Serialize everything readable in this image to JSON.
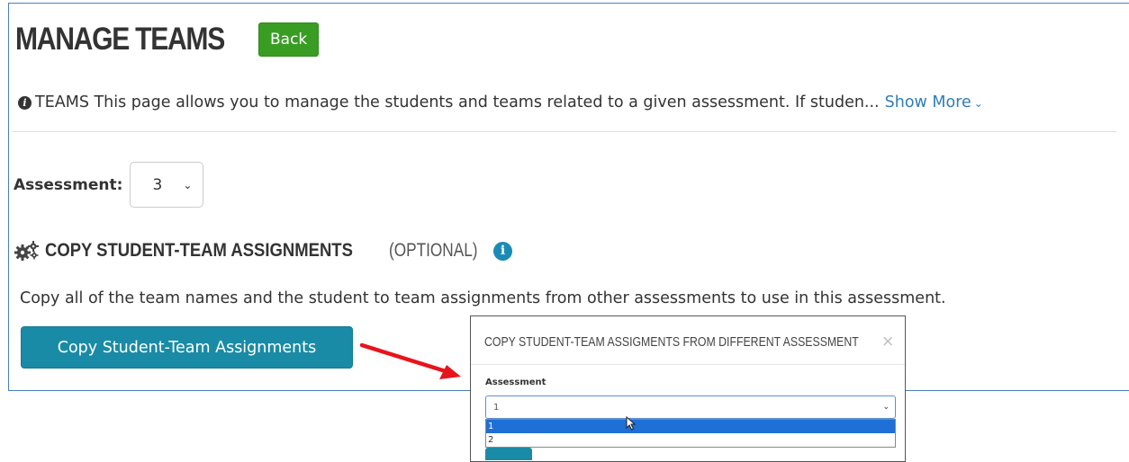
{
  "header": {
    "title": "MANAGE TEAMS",
    "back_label": "Back"
  },
  "info": {
    "text": "TEAMS This page allows you to manage the students and teams related to a given assessment. If studen...",
    "show_more": "Show More"
  },
  "assessment": {
    "label": "Assessment:",
    "selected": "3"
  },
  "copy_section": {
    "title": "COPY STUDENT-TEAM ASSIGNMENTS",
    "optional": "(OPTIONAL)",
    "description": "Copy all of the team names and the student to team assignments from other assessments to use in this assessment.",
    "button_label": "Copy Student-Team Assignments"
  },
  "modal": {
    "title": "COPY STUDENT-TEAM ASSIGMENTS FROM DIFFERENT ASSESSMENT",
    "close": "×",
    "field_label": "Assessment",
    "selected": "1",
    "options": [
      "1",
      "2"
    ]
  },
  "colors": {
    "back_button": "#3a9d23",
    "primary_button": "#1a8ba6",
    "link": "#2f7db8",
    "info_icon": "#1a8bb5",
    "dropdown_highlight": "#1e6fd6",
    "arrow": "#e8141b"
  },
  "icons": {
    "info": "info-circle-icon",
    "gears": "gears-icon",
    "chevron": "chevron-down-icon",
    "close": "close-icon",
    "cursor": "mouse-cursor-icon"
  }
}
